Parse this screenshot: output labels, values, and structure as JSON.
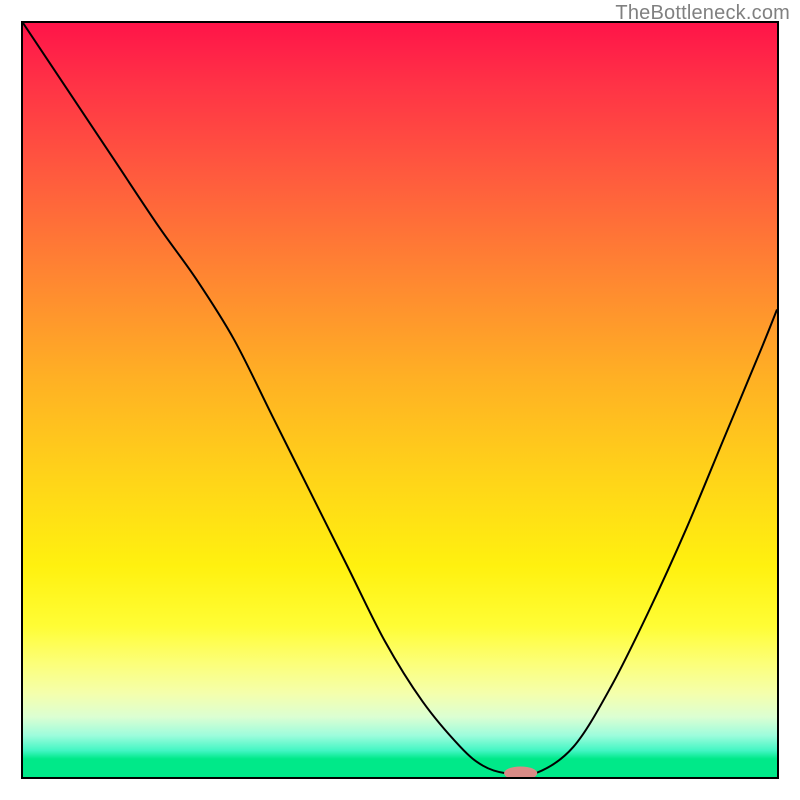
{
  "watermark": "TheBottleneck.com",
  "chart_data": {
    "type": "line",
    "title": "",
    "xlabel": "",
    "ylabel": "",
    "xlim": [
      0,
      100
    ],
    "ylim": [
      0,
      100
    ],
    "legend": false,
    "grid": false,
    "background_gradient_stops": [
      {
        "pct": 0,
        "color": "#ff1449"
      },
      {
        "pct": 8,
        "color": "#ff3246"
      },
      {
        "pct": 20,
        "color": "#ff5a3e"
      },
      {
        "pct": 33,
        "color": "#ff8432"
      },
      {
        "pct": 47,
        "color": "#ffb024"
      },
      {
        "pct": 60,
        "color": "#ffd319"
      },
      {
        "pct": 72,
        "color": "#fff10f"
      },
      {
        "pct": 80,
        "color": "#fffd35"
      },
      {
        "pct": 85,
        "color": "#fcff7a"
      },
      {
        "pct": 89,
        "color": "#f4ffad"
      },
      {
        "pct": 92,
        "color": "#dcffd2"
      },
      {
        "pct": 94.5,
        "color": "#9dfcdc"
      },
      {
        "pct": 96.5,
        "color": "#42f6c3"
      },
      {
        "pct": 97.6,
        "color": "#00e989"
      },
      {
        "pct": 100,
        "color": "#00e989"
      }
    ],
    "series": [
      {
        "name": "curve",
        "color": "#000000",
        "x": [
          0,
          6,
          12,
          18,
          23,
          28,
          33,
          38,
          43,
          48,
          53,
          58,
          61,
          64,
          68,
          73,
          78,
          83,
          88,
          93,
          98,
          100
        ],
        "y": [
          100,
          91,
          82,
          73,
          66,
          58,
          48,
          38,
          28,
          18,
          10,
          4,
          1.5,
          0.5,
          0.5,
          4,
          12,
          22,
          33,
          45,
          57,
          62
        ]
      }
    ],
    "marker": {
      "name": "optimal-marker",
      "color": "#d98b86",
      "x": 66,
      "y": 0.5,
      "rx": 2.2,
      "ry": 0.9
    }
  }
}
